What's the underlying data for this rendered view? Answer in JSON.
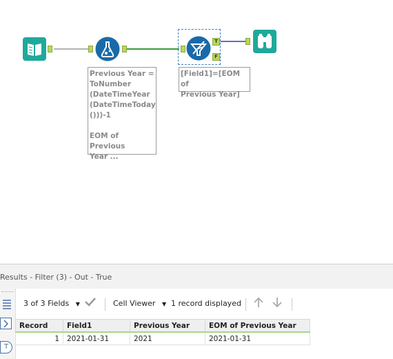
{
  "annotations": {
    "formula": "Previous Year =\nToNumber\n(DateTimeYear\n(DateTimeToday\n()))-1\n\nEOM of Previous\nYear ...",
    "filter": "[Field1]=[EOM of\nPrevious Year]"
  },
  "anchors": {
    "true_label": "T",
    "false_label": "F"
  },
  "results": {
    "title": "Results - Filter (3) - Out - True",
    "fields_label": "3 of 3 Fields",
    "cell_viewer_label": "Cell Viewer",
    "records_label": "1 record displayed",
    "left_tabs": [
      "T"
    ],
    "columns": [
      "Record",
      "Field1",
      "Previous Year",
      "EOM of Previous Year"
    ],
    "rows": [
      [
        "1",
        "2021-01-31",
        "2021",
        "2021-01-31"
      ]
    ]
  },
  "colors": {
    "input_tool": "#1fa99b",
    "formula_tool": "#1a6aa8",
    "filter_tool": "#1a6aa8",
    "browse_tool": "#1fa99b",
    "anchor": "#b9d65c",
    "connector_green": "#3c9a3c",
    "connector_blue": "#2b3da8"
  }
}
